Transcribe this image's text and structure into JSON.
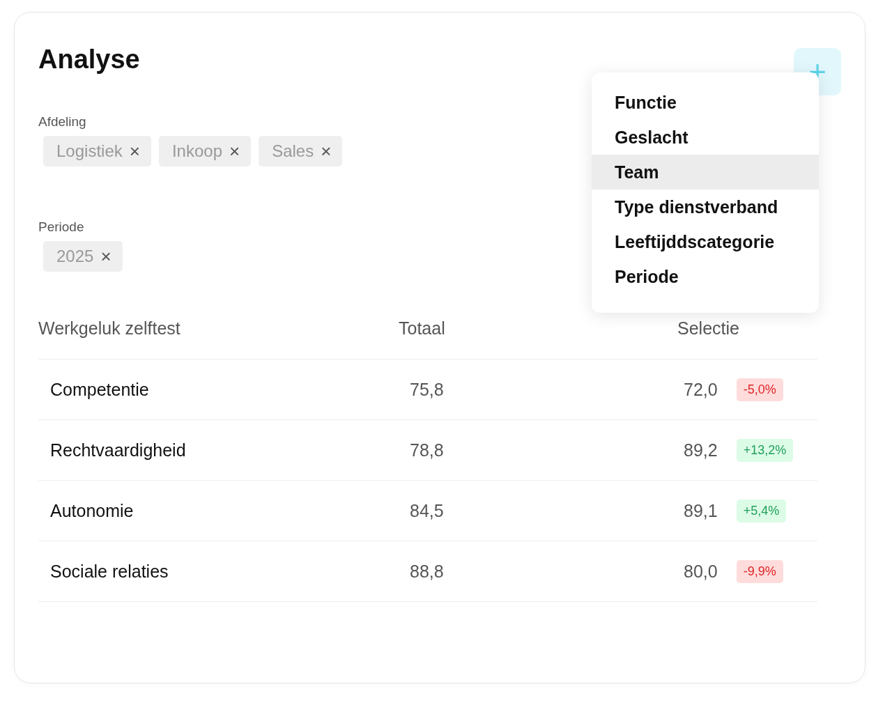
{
  "title": "Analyse",
  "add_button": {
    "label": "+"
  },
  "filters": [
    {
      "label": "Afdeling",
      "chips": [
        {
          "label": "Logistiek",
          "remove": "×"
        },
        {
          "label": "Inkoop",
          "remove": "×"
        },
        {
          "label": "Sales",
          "remove": "×"
        }
      ]
    },
    {
      "label": "Periode",
      "chips": [
        {
          "label": "2025",
          "remove": "×"
        }
      ]
    }
  ],
  "menu": {
    "items": [
      {
        "label": "Functie",
        "selected": false
      },
      {
        "label": "Geslacht",
        "selected": false
      },
      {
        "label": "Team",
        "selected": true
      },
      {
        "label": "Type dienstverband",
        "selected": false
      },
      {
        "label": "Leeftijddscategorie",
        "selected": false
      },
      {
        "label": "Periode",
        "selected": false
      }
    ]
  },
  "table": {
    "columns": [
      "Werkgeluk zelftest",
      "Totaal",
      "Selectie"
    ],
    "rows": [
      {
        "name": "Competentie",
        "total": "75,8",
        "selection": "72,0",
        "change": "-5,0%",
        "kind": "decrease"
      },
      {
        "name": "Rechtvaardigheid",
        "total": "78,8",
        "selection": "89,2",
        "change": "+13,2%",
        "kind": "increase"
      },
      {
        "name": "Autonomie",
        "total": "84,5",
        "selection": "89,1",
        "change": "+5,4%",
        "kind": "increase"
      },
      {
        "name": "Sociale relaties",
        "total": "88,8",
        "selection": "80,0",
        "change": "-9,9%",
        "kind": "decrease"
      }
    ]
  }
}
